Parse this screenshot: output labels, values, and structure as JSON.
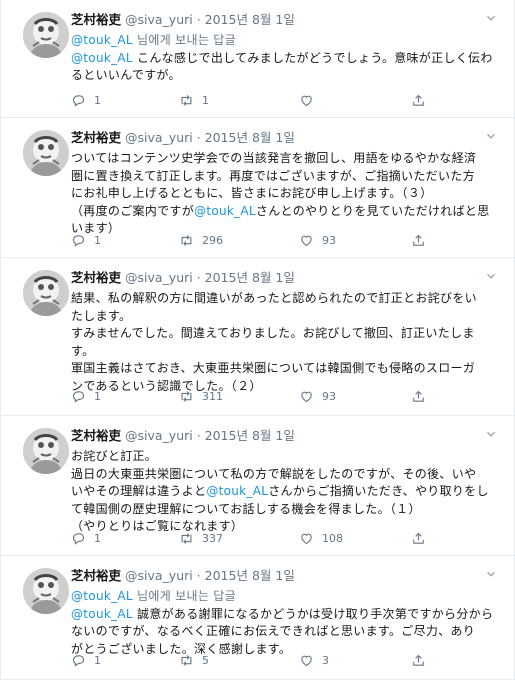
{
  "tweets": [
    {
      "name": "芝村裕吏",
      "handle": "@siva_yuri",
      "date": "2015년 8월 1일",
      "lines": [
        [
          {
            "t": "@touk_AL",
            "c": "link"
          },
          {
            "t": " 님에게 보내는 답글",
            "c": "reply-to"
          }
        ],
        [
          {
            "t": "@touk_AL",
            "c": "link"
          },
          {
            "t": " こんな感じで出してみましたがどうでしょう。意味が正しく伝わ",
            "c": ""
          }
        ],
        [
          {
            "t": "るといいんですが。",
            "c": ""
          }
        ]
      ],
      "reply": "1",
      "retweet": "1",
      "like": ""
    },
    {
      "name": "芝村裕吏",
      "handle": "@siva_yuri",
      "date": "2015년 8월 1일",
      "lines": [
        [
          {
            "t": "ついてはコンテンツ史学会での当該発言を撤回し、用語をゆるやかな経済",
            "c": ""
          }
        ],
        [
          {
            "t": "圏に置き換えて訂正します。再度ではございますが、ご指摘いただいた方",
            "c": ""
          }
        ],
        [
          {
            "t": "にお礼申し上げるとともに、皆さまにお詫び申し上げます。（３）",
            "c": ""
          }
        ],
        [
          {
            "t": "（再度のご案内ですが",
            "c": ""
          },
          {
            "t": "@touk_AL",
            "c": "link"
          },
          {
            "t": "さんとのやりとりを見ていただければと思",
            "c": ""
          }
        ],
        [
          {
            "t": "います）",
            "c": ""
          }
        ]
      ],
      "reply": "1",
      "retweet": "296",
      "like": "93"
    },
    {
      "name": "芝村裕吏",
      "handle": "@siva_yuri",
      "date": "2015년 8월 1일",
      "lines": [
        [
          {
            "t": "結果、私の解釈の方に間違いがあったと認められたので訂正とお詫びをい",
            "c": ""
          }
        ],
        [
          {
            "t": "たします。",
            "c": ""
          }
        ],
        [
          {
            "t": "すみませんでした。間違えておりました。お詫びして撤回、訂正いたしま",
            "c": ""
          }
        ],
        [
          {
            "t": "す。",
            "c": ""
          }
        ],
        [
          {
            "t": "軍国主義はさておき、大東亜共栄圏については韓国側でも侵略のスローガ",
            "c": ""
          }
        ],
        [
          {
            "t": "ンであるという認識でした。（２）",
            "c": ""
          }
        ]
      ],
      "reply": "1",
      "retweet": "311",
      "like": "93"
    },
    {
      "name": "芝村裕吏",
      "handle": "@siva_yuri",
      "date": "2015년 8월 1일",
      "lines": [
        [
          {
            "t": "お詫びと訂正。",
            "c": ""
          }
        ],
        [
          {
            "t": "過日の大東亜共栄圏について私の方で解説をしたのですが、その後、いや",
            "c": ""
          }
        ],
        [
          {
            "t": "いやその理解は違うよと",
            "c": ""
          },
          {
            "t": "@touk_AL",
            "c": "link"
          },
          {
            "t": "さんからご指摘いただき、やり取りをし",
            "c": ""
          }
        ],
        [
          {
            "t": "て韓国側の歴史理解についてお話しする機会を得ました。（１）",
            "c": ""
          }
        ],
        [
          {
            "t": "（やりとりはご覧になれます）",
            "c": ""
          }
        ]
      ],
      "reply": "1",
      "retweet": "337",
      "like": "108"
    },
    {
      "name": "芝村裕吏",
      "handle": "@siva_yuri",
      "date": "2015년 8월 1일",
      "lines": [
        [
          {
            "t": "@touk_AL",
            "c": "link"
          },
          {
            "t": " 님에게 보내는 답글",
            "c": "reply-to"
          }
        ],
        [
          {
            "t": "@touk_AL",
            "c": "link"
          },
          {
            "t": " 誠意がある謝罪になるかどうかは受け取り手次第ですから分から",
            "c": ""
          }
        ],
        [
          {
            "t": "ないのですが、なるべく正確にお伝えできればと思います。ご尽力、あり",
            "c": ""
          }
        ],
        [
          {
            "t": "がとうございました。深く感謝します。",
            "c": ""
          }
        ]
      ],
      "reply": "1",
      "retweet": "5",
      "like": "3"
    }
  ],
  "separator": "·",
  "colors": {
    "link": "#1b95e0",
    "muted": "#657786",
    "text": "#14171a",
    "border": "#e6ecf0"
  },
  "icons": {
    "reply": "reply-icon",
    "retweet": "retweet-icon",
    "like": "heart-icon",
    "share": "share-icon",
    "menu": "chevron-down-icon"
  }
}
